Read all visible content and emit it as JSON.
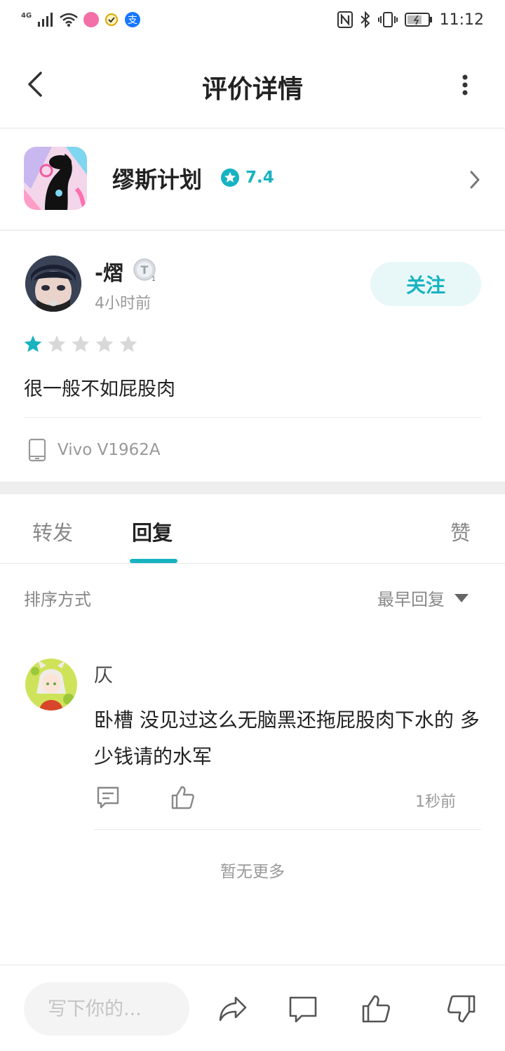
{
  "status_bar": {
    "network": "4G",
    "time": "11:12",
    "icons": [
      "signal-icon",
      "wifi-icon",
      "app-notification-icon",
      "check-icon",
      "alipay-icon",
      "nfc-icon",
      "bluetooth-icon",
      "vibrate-icon",
      "battery-icon"
    ]
  },
  "header": {
    "title": "评价详情"
  },
  "app": {
    "name": "缪斯计划",
    "rating": "7.4"
  },
  "review": {
    "username": "-熠",
    "time_ago": "4小时前",
    "follow_label": "关注",
    "star_rating": 1,
    "star_max": 5,
    "text": "很一般不如屁股肉",
    "device": "Vivo V1962A"
  },
  "tabs": [
    {
      "label": "转发",
      "active": false
    },
    {
      "label": "回复",
      "active": true
    },
    {
      "label": "赞",
      "active": false
    }
  ],
  "sort": {
    "label": "排序方式",
    "selected": "最早回复"
  },
  "comments": [
    {
      "name": "仄",
      "text": "卧槽 没见过这么无脑黑还拖屁股肉下水的 多少钱请的水军",
      "time": "1秒前"
    }
  ],
  "no_more": "暂无更多",
  "bottom_bar": {
    "input_placeholder": "写下你的..."
  },
  "colors": {
    "accent": "#17b3c1",
    "star_empty": "#d8d8d8",
    "follow_bg": "#e8f8f9"
  }
}
